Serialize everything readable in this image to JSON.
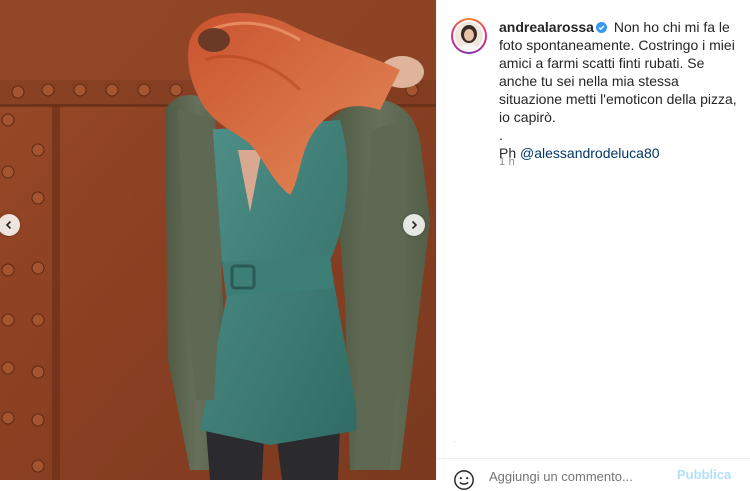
{
  "post": {
    "username": "andrealarossa",
    "verified": true,
    "caption_text": "Non ho chi mi fa le foto spontaneamente. Costringo i miei amici a farmi scatti finti rubati. Se anche tu sei nella mia stessa situazione metti l'emoticon della pizza, io capirò.",
    "caption_dot": ".",
    "photo_credit_prefix": "Ph",
    "mention": "@alessandrodeluca80",
    "time": "1 h"
  },
  "comment": {
    "placeholder": "Aggiungi un commento...",
    "publish_label": "Pubblica"
  },
  "icons": {
    "prev": "chevron-left-icon",
    "next": "chevron-right-icon",
    "verified": "verified-badge-icon",
    "emoji": "emoji-smile-icon"
  },
  "colors": {
    "text": "#262626",
    "mention": "#00376b",
    "verified": "#3897f0",
    "muted": "#8e8e8e",
    "publish": "#b2dffc"
  }
}
